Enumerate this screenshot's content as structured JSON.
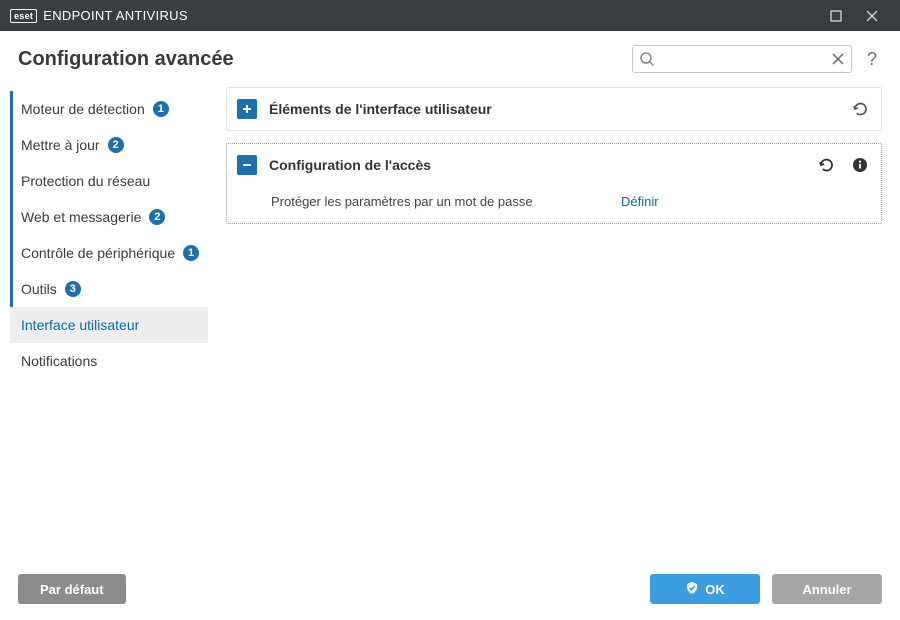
{
  "titlebar": {
    "brand": "eset",
    "product": "ENDPOINT ANTIVIRUS"
  },
  "header": {
    "title": "Configuration avancée",
    "search_placeholder": ""
  },
  "sidebar": {
    "items": [
      {
        "label": "Moteur de détection",
        "badge": "1",
        "has_bar": true
      },
      {
        "label": "Mettre à jour",
        "badge": "2",
        "has_bar": true
      },
      {
        "label": "Protection du réseau",
        "badge": "",
        "has_bar": true
      },
      {
        "label": "Web et messagerie",
        "badge": "2",
        "has_bar": true
      },
      {
        "label": "Contrôle de périphérique",
        "badge": "1",
        "has_bar": true
      },
      {
        "label": "Outils",
        "badge": "3",
        "has_bar": true
      },
      {
        "label": "Interface utilisateur",
        "badge": "",
        "has_bar": false,
        "selected": true
      },
      {
        "label": "Notifications",
        "badge": "",
        "has_bar": false
      }
    ]
  },
  "panels": {
    "ui_elements": {
      "title": "Éléments de l'interface utilisateur"
    },
    "access_setup": {
      "title": "Configuration de l'accès",
      "setting_label": "Protéger les paramètres par un mot de passe",
      "setting_action": "Définir"
    }
  },
  "footer": {
    "default_label": "Par défaut",
    "ok_label": "OK",
    "cancel_label": "Annuler"
  }
}
